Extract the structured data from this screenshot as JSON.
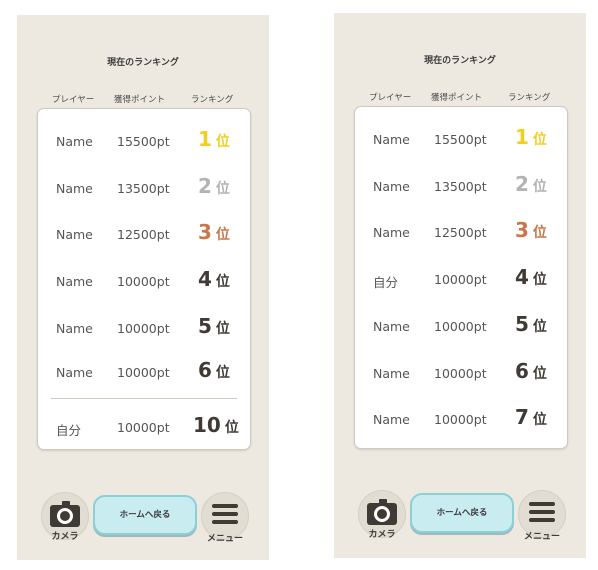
{
  "colors": {
    "gold": "#f2cf1f",
    "silver": "#b3b3b3",
    "bronze": "#c9774a",
    "background": "#ede9e0",
    "home_button": "#c9ecf1"
  },
  "screens": [
    {
      "title": "現在のランキング",
      "headers": {
        "player": "プレイヤー",
        "points": "獲得ポイント",
        "ranking": "ランキング"
      },
      "rows": [
        {
          "name": "Name",
          "points": "15500pt",
          "rank": "1",
          "unit": "位"
        },
        {
          "name": "Name",
          "points": "13500pt",
          "rank": "2",
          "unit": "位"
        },
        {
          "name": "Name",
          "points": "12500pt",
          "rank": "3",
          "unit": "位"
        },
        {
          "name": "Name",
          "points": "10000pt",
          "rank": "4",
          "unit": "位"
        },
        {
          "name": "Name",
          "points": "10000pt",
          "rank": "5",
          "unit": "位"
        },
        {
          "name": "Name",
          "points": "10000pt",
          "rank": "6",
          "unit": "位"
        }
      ],
      "self_row": {
        "name": "自分",
        "points": "10000pt",
        "rank": "10",
        "unit": "位"
      },
      "bottom": {
        "camera_label": "カメラ",
        "camera_icon": "camera-icon",
        "home_label": "ホームへ戻る",
        "menu_label": "メニュー",
        "menu_icon": "hamburger-menu-icon"
      }
    },
    {
      "title": "現在のランキング",
      "headers": {
        "player": "プレイヤー",
        "points": "獲得ポイント",
        "ranking": "ランキング"
      },
      "rows": [
        {
          "name": "Name",
          "points": "15500pt",
          "rank": "1",
          "unit": "位"
        },
        {
          "name": "Name",
          "points": "13500pt",
          "rank": "2",
          "unit": "位"
        },
        {
          "name": "Name",
          "points": "12500pt",
          "rank": "3",
          "unit": "位"
        },
        {
          "name": "自分",
          "points": "10000pt",
          "rank": "4",
          "unit": "位"
        },
        {
          "name": "Name",
          "points": "10000pt",
          "rank": "5",
          "unit": "位"
        },
        {
          "name": "Name",
          "points": "10000pt",
          "rank": "6",
          "unit": "位"
        },
        {
          "name": "Name",
          "points": "10000pt",
          "rank": "7",
          "unit": "位"
        }
      ],
      "bottom": {
        "camera_label": "カメラ",
        "camera_icon": "camera-icon",
        "home_label": "ホームへ戻る",
        "menu_label": "メニュー",
        "menu_icon": "hamburger-menu-icon"
      }
    }
  ]
}
